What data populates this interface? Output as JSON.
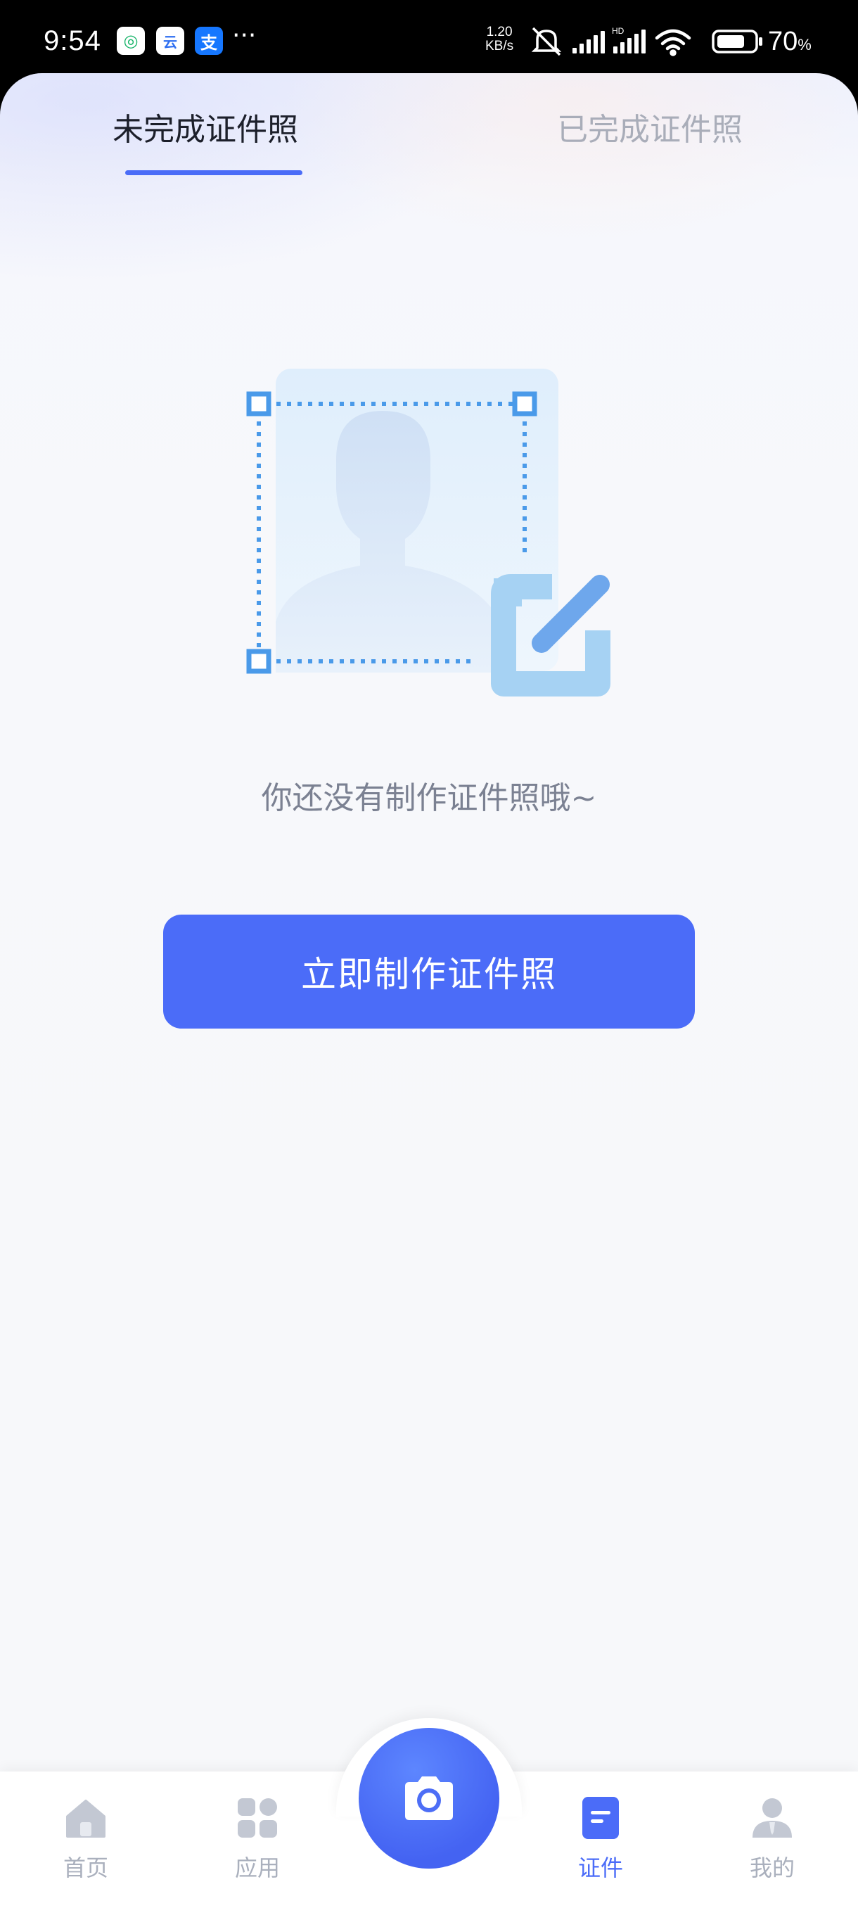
{
  "status_bar": {
    "time": "9:54",
    "app_badge_1": "◎",
    "app_badge_2": "云",
    "app_badge_3": "支",
    "more": "···",
    "speed_value": "1.20",
    "speed_unit": "KB/s",
    "battery_level": "70",
    "battery_unit": "%"
  },
  "tabs": {
    "active_label": "未完成证件照",
    "inactive_label": "已完成证件照"
  },
  "empty_state": {
    "message": "你还没有制作证件照哦~",
    "button_label": "立即制作证件照"
  },
  "bottom_nav": {
    "items": [
      {
        "label": "首页",
        "icon": "home-icon"
      },
      {
        "label": "应用",
        "icon": "apps-grid-icon"
      },
      {
        "label": "证件",
        "icon": "document-icon",
        "active": true
      },
      {
        "label": "我的",
        "icon": "user-icon"
      }
    ],
    "center_icon": "camera-icon"
  },
  "colors": {
    "accent": "#4b6cf8",
    "inactive_text": "#aab0bd",
    "message_text": "#7b8192",
    "illustration_blue": "#4a9ae9",
    "illustration_light": "#a6d2f3"
  }
}
